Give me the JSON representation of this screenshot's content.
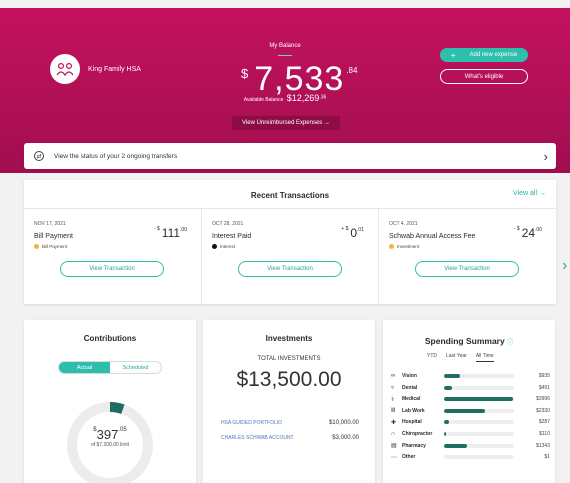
{
  "header": {
    "account_name": "King Family HSA",
    "balance_label": "My Balance",
    "balance_currency": "$",
    "balance_main": "7,533",
    "balance_cents": ".84",
    "available_label": "Available Balance",
    "available_amount": "$12,269",
    "available_cents": ".36",
    "unreimbursed_label": "View Unreimbursed Expenses  →",
    "add_expense_label": "Add new expense",
    "add_expense_icon": "+",
    "whats_eligible_label": "What's eligible"
  },
  "transfers": {
    "text": "View the status of your 2 ongoing transfers",
    "chevron": "›",
    "icon": "⇄"
  },
  "recent": {
    "title": "Recent Transactions",
    "view_all": "View all →",
    "next_chevron": "›",
    "items": [
      {
        "date": "NOV 17, 2021",
        "title": "Bill Payment",
        "sign": "- $",
        "amount": "111",
        "cents": ".00",
        "tag": "Bill Payment",
        "tag_color": "#f0b33c",
        "button": "View Transaction"
      },
      {
        "date": "OCT 28, 2021",
        "title": "Interest Paid",
        "sign": "+ $",
        "amount": "0",
        "cents": ".01",
        "tag": "Interest",
        "tag_color": "#111111",
        "button": "View Transaction"
      },
      {
        "date": "OCT 4, 2021",
        "title": "Schwab Annual Access Fee",
        "sign": "- $",
        "amount": "24",
        "cents": ".00",
        "tag": "Investment",
        "tag_color": "#f0b33c",
        "button": "View Transaction"
      }
    ]
  },
  "contributions": {
    "title": "Contributions",
    "tab_actual": "Actual",
    "tab_scheduled": "Scheduled",
    "amount_sup": "$",
    "amount": "397",
    "cents": ".05",
    "limit_text": "of $7,200.00 limit",
    "progress_fraction": 0.055
  },
  "investments": {
    "title": "Investments",
    "total_label": "TOTAL INVESTMENTS",
    "total": "$13,500.00",
    "rows": [
      {
        "name": "HSA GUIDED PORTFOLIO",
        "value": "$10,000.00"
      },
      {
        "name": "CHARLES SCHWAB ACCOUNT",
        "value": "$3,000.00"
      }
    ]
  },
  "spending": {
    "title": "Spending Summary",
    "info_icon": "ⓘ",
    "tabs": [
      "YTD",
      "Last Year",
      "All Time"
    ],
    "active_tab": "All Time",
    "categories": [
      {
        "name": "Vision",
        "icon": "∞",
        "value": "$935",
        "fraction": 0.23
      },
      {
        "name": "Dental",
        "icon": "▿",
        "value": "$491",
        "fraction": 0.12
      },
      {
        "name": "Medical",
        "icon": "⚕",
        "value": "$3996",
        "fraction": 0.98
      },
      {
        "name": "Lab Work",
        "icon": "Ⅲ",
        "value": "$2330",
        "fraction": 0.58
      },
      {
        "name": "Hospital",
        "icon": "✚",
        "value": "$287",
        "fraction": 0.07
      },
      {
        "name": "Chiropractor",
        "icon": "∩",
        "value": "$110",
        "fraction": 0.03
      },
      {
        "name": "Pharmacy",
        "icon": "▤",
        "value": "$1343",
        "fraction": 0.33
      },
      {
        "name": "Other",
        "icon": "⋯",
        "value": "$1",
        "fraction": 0.0
      }
    ]
  },
  "colors": {
    "brand": "#b8105a",
    "accent": "#2dbfac",
    "bar": "#1f6e61"
  }
}
